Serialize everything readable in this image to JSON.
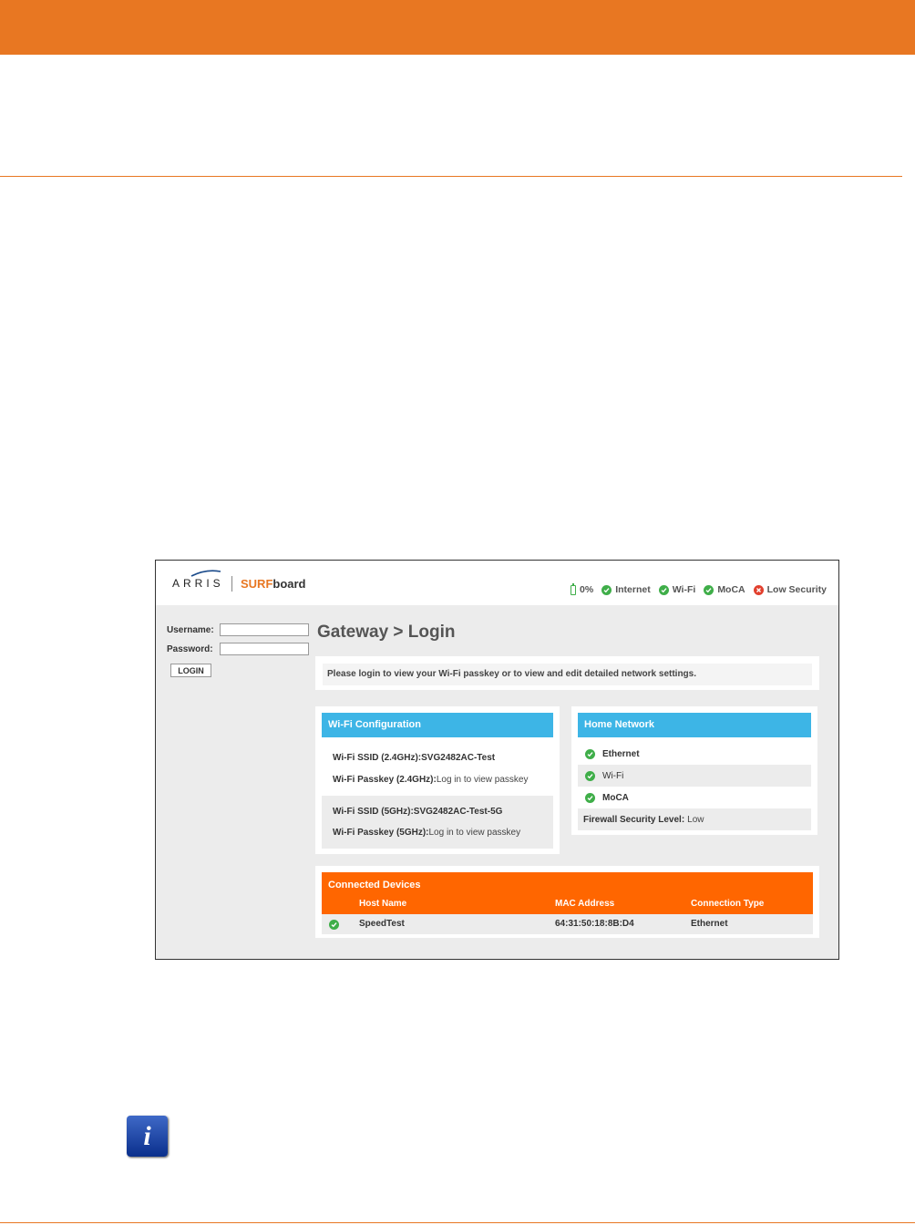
{
  "brand": {
    "arris": "ARRIS",
    "surf": "SURF",
    "board": "board"
  },
  "status": {
    "battery": "0%",
    "items": [
      {
        "label": "Internet",
        "state": "ok"
      },
      {
        "label": "Wi-Fi",
        "state": "ok"
      },
      {
        "label": "MoCA",
        "state": "ok"
      },
      {
        "label": "Low Security",
        "state": "error"
      }
    ]
  },
  "login": {
    "username_label": "Username:",
    "username_value": "",
    "password_label": "Password:",
    "password_value": "",
    "button_label": "LOGIN"
  },
  "page_title": "Gateway > Login",
  "notice": "Please login to view your Wi-Fi passkey or to view and edit detailed network settings.",
  "wifi_config": {
    "title": "Wi-Fi Configuration",
    "ssid_24_label": "Wi-Fi SSID (2.4GHz):",
    "ssid_24_value": "SVG2482AC-Test",
    "passkey_24_label": "Wi-Fi Passkey (2.4GHz):",
    "passkey_24_value": "Log in to view passkey",
    "ssid_5_label": "Wi-Fi SSID (5GHz):",
    "ssid_5_value": "SVG2482AC-Test-5G",
    "passkey_5_label": "Wi-Fi Passkey (5GHz):",
    "passkey_5_value": "Log in to view passkey"
  },
  "home_network": {
    "title": "Home Network",
    "items": [
      "Ethernet",
      "Wi-Fi",
      "MoCA"
    ],
    "firewall_label": "Firewall Security Level:",
    "firewall_value": "Low"
  },
  "connected_devices": {
    "title": "Connected Devices",
    "columns": [
      "Host Name",
      "MAC Address",
      "Connection Type"
    ],
    "rows": [
      {
        "host": "SpeedTest",
        "mac": "64:31:50:18:8B:D4",
        "type": "Ethernet"
      }
    ]
  },
  "colors": {
    "accent": "#e87722",
    "blue_header": "#3db5e6",
    "orange_header": "#ff6600",
    "ok": "#3fae49",
    "error": "#e2402e"
  }
}
